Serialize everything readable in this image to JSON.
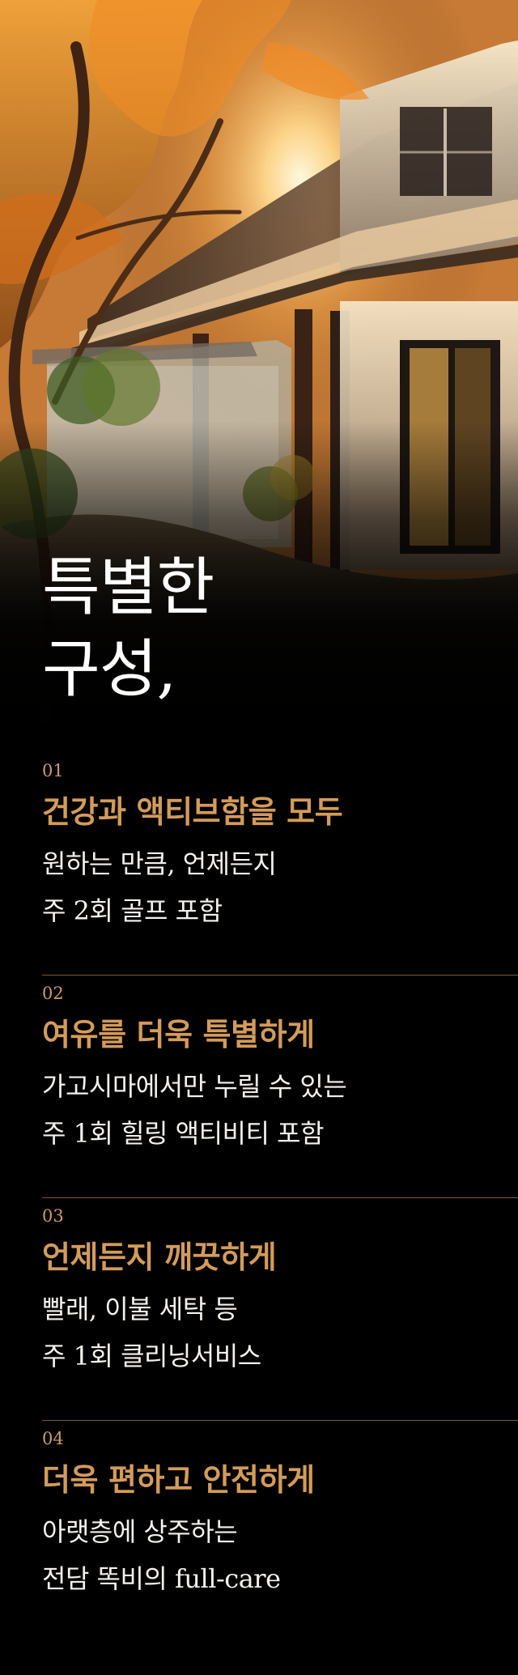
{
  "hero": {
    "title_line1": "특별한",
    "title_line2": "구성,"
  },
  "features": [
    {
      "number": "01",
      "title": "건강과 액티브함을 모두",
      "desc_line1": "원하는 만큼, 언제든지",
      "desc_line2": "주 2회 골프 포함"
    },
    {
      "number": "02",
      "title": "여유를 더욱 특별하게",
      "desc_line1": "가고시마에서만 누릴 수 있는",
      "desc_line2": "주 1회 힐링 액티비티 포함"
    },
    {
      "number": "03",
      "title": "언제든지 깨끗하게",
      "desc_line1": "빨래, 이불 세탁 등",
      "desc_line2": "주 1회 클리닝서비스"
    },
    {
      "number": "04",
      "title": "더욱 편하고 안전하게",
      "desc_line1": "아랫층에 상주하는",
      "desc_line2": "전담 똑비의 full-care"
    }
  ],
  "colors": {
    "accent": "#d49b59",
    "number": "#cf9b63",
    "divider": "#7b5a35",
    "background": "#000000",
    "text": "#f4f1ed"
  }
}
